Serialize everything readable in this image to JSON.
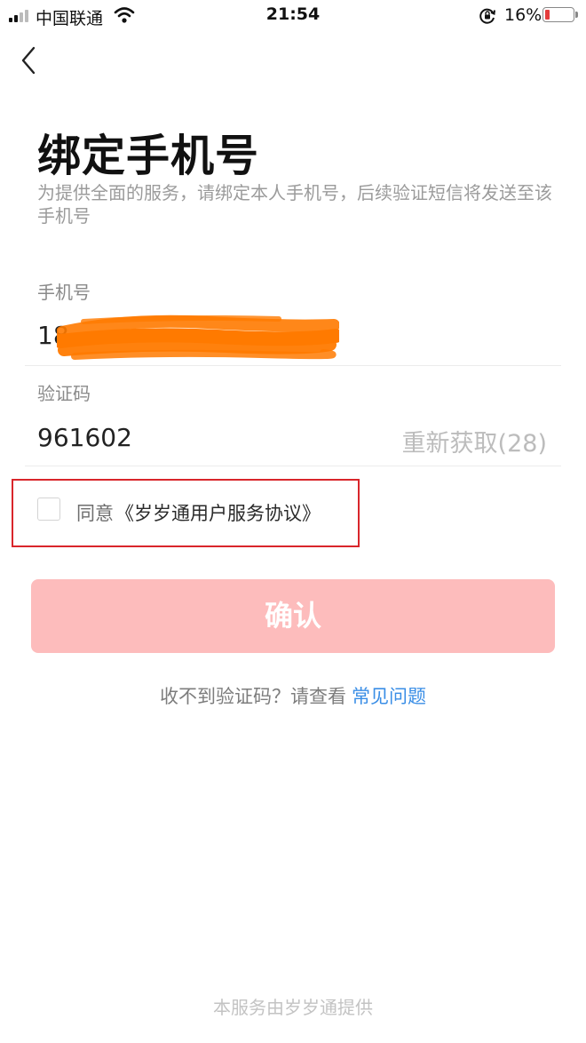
{
  "status_bar": {
    "carrier": "中国联通",
    "time": "21:54",
    "battery_percent": "16%",
    "battery_level": 0.16,
    "battery_color": "#e43c3c",
    "icons": [
      "signal-icon",
      "wifi-icon",
      "rotation-lock-icon",
      "battery-icon"
    ]
  },
  "nav": {
    "back_icon": "chevron-left-icon"
  },
  "header": {
    "title": "绑定手机号",
    "subtitle": "为提供全面的服务，请绑定本人手机号，后续验证短信将发送至该手机号"
  },
  "phone": {
    "label": "手机号",
    "value_prefix": "18",
    "redaction_color": "#ff7a00"
  },
  "code": {
    "label": "验证码",
    "value": "961602",
    "resend_label": "重新获取(28)"
  },
  "agreement": {
    "prefix": "同意",
    "link": "《岁岁通用户服务协议》",
    "checked": false,
    "highlight_color": "#d9262b"
  },
  "confirm": {
    "label": "确认",
    "color": "#fdbcbc"
  },
  "help": {
    "text": "收不到验证码？请查看",
    "link": "常见问题",
    "link_color": "#3a8ee6"
  },
  "footer": {
    "text": "本服务由岁岁通提供"
  }
}
